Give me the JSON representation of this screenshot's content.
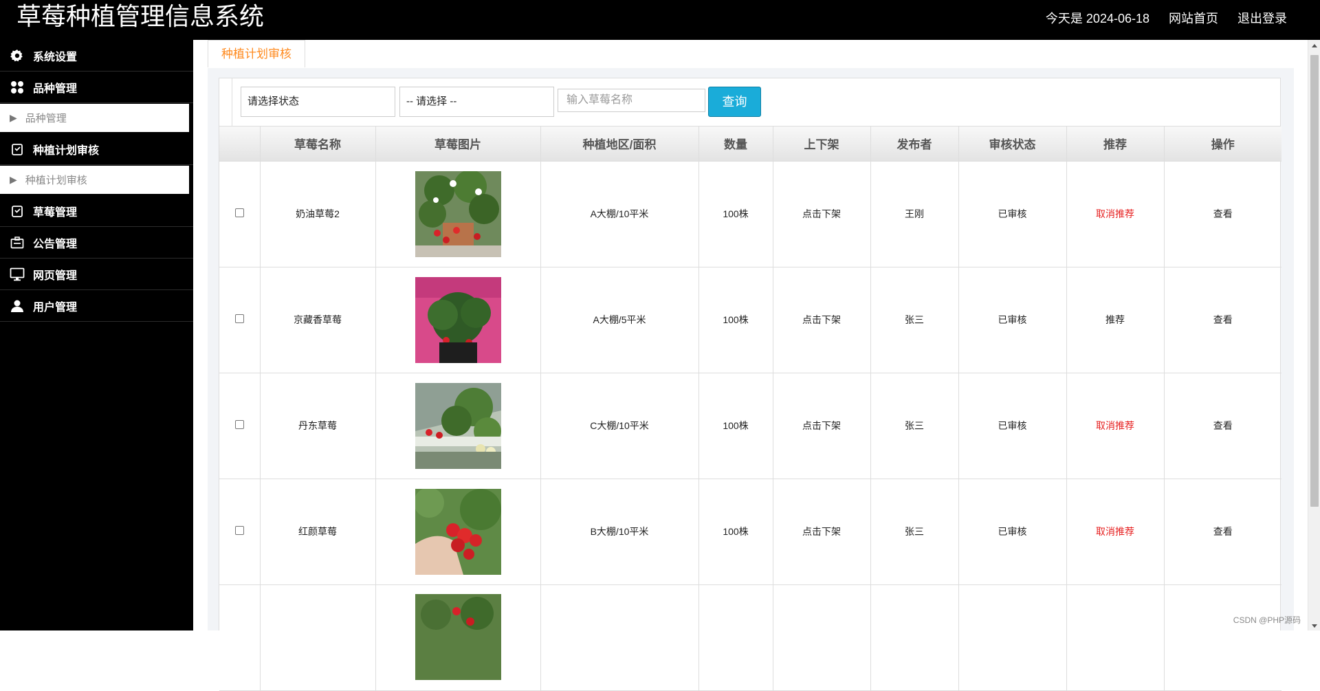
{
  "header": {
    "app_title": "草莓种植管理信息系统",
    "date_text": "今天是 2024-06-18",
    "home_link": "网站首页",
    "logout_link": "退出登录"
  },
  "sidebar": {
    "items": [
      {
        "label": "系统设置",
        "icon": "gear-icon"
      },
      {
        "label": "品种管理",
        "icon": "apps-grid-icon",
        "sub": "品种管理"
      },
      {
        "label": "种植计划审核",
        "icon": "clipboard-icon",
        "sub": "种植计划审核"
      },
      {
        "label": "草莓管理",
        "icon": "clipboard-icon"
      },
      {
        "label": "公告管理",
        "icon": "notice-board-icon"
      },
      {
        "label": "网页管理",
        "icon": "monitor-icon"
      },
      {
        "label": "用户管理",
        "icon": "user-icon"
      }
    ]
  },
  "tabs": {
    "active_label": "种植计划审核"
  },
  "filters": {
    "status_select": "请选择状态",
    "second_select": "-- 请选择 --",
    "search_placeholder": "输入草莓名称",
    "query_button": "查询"
  },
  "table": {
    "headers": [
      "草莓名称",
      "草莓图片",
      "种植地区/面积",
      "数量",
      "上下架",
      "发布者",
      "审核状态",
      "推荐",
      "操作"
    ],
    "rows": [
      {
        "name": "奶油草莓2",
        "area": "A大棚/10平米",
        "qty": "100株",
        "shelf": "点击下架",
        "publisher": "王刚",
        "status": "已审核",
        "recommend": "取消推荐",
        "recommend_active": true,
        "op": "查看"
      },
      {
        "name": "京藏香草莓",
        "area": "A大棚/5平米",
        "qty": "100株",
        "shelf": "点击下架",
        "publisher": "张三",
        "status": "已审核",
        "recommend": "推荐",
        "recommend_active": false,
        "op": "查看"
      },
      {
        "name": "丹东草莓",
        "area": "C大棚/10平米",
        "qty": "100株",
        "shelf": "点击下架",
        "publisher": "张三",
        "status": "已审核",
        "recommend": "取消推荐",
        "recommend_active": true,
        "op": "查看"
      },
      {
        "name": "红颜草莓",
        "area": "B大棚/10平米",
        "qty": "100株",
        "shelf": "点击下架",
        "publisher": "张三",
        "status": "已审核",
        "recommend": "取消推荐",
        "recommend_active": true,
        "op": "查看"
      }
    ]
  },
  "watermark": "CSDN @PHP源码",
  "colors": {
    "accent_orange": "#ff8a1e",
    "query_button": "#1aacd9",
    "recommend_red": "#e61f1f",
    "sidebar_bg": "#000000"
  }
}
